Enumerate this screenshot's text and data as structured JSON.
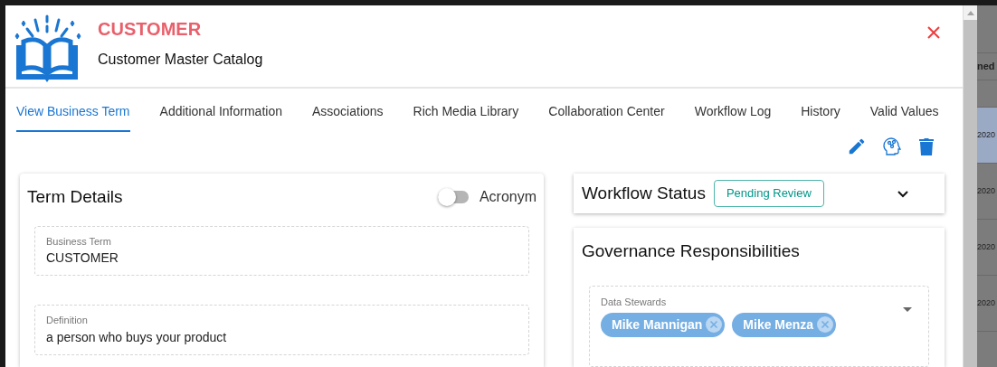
{
  "header": {
    "title": "CUSTOMER",
    "subtitle": "Customer Master Catalog"
  },
  "tabs": [
    {
      "label": "View Business Term",
      "selected": true
    },
    {
      "label": "Additional Information",
      "selected": false
    },
    {
      "label": "Associations",
      "selected": false
    },
    {
      "label": "Rich Media Library",
      "selected": false
    },
    {
      "label": "Collaboration Center",
      "selected": false
    },
    {
      "label": "Workflow Log",
      "selected": false
    },
    {
      "label": "History",
      "selected": false
    },
    {
      "label": "Valid Values",
      "selected": false
    }
  ],
  "term_details": {
    "title": "Term Details",
    "acronym": {
      "label": "Acronym",
      "on": false
    },
    "fields": [
      {
        "label": "Business Term",
        "value": "CUSTOMER"
      },
      {
        "label": "Definition",
        "value": "a person who buys your product"
      }
    ]
  },
  "workflow_status": {
    "title": "Workflow Status",
    "status": "Pending Review",
    "expanded": false
  },
  "governance": {
    "title": "Governance Responsibilities",
    "field": {
      "label": "Data Stewards",
      "chips": [
        "Mike Mannigan",
        "Mike Menza"
      ]
    }
  },
  "background_table": {
    "column_header": "ned",
    "rows": [
      {
        "cell": "2020",
        "selected": true
      },
      {
        "cell": "2020",
        "selected": false
      },
      {
        "cell": "2020",
        "selected": false
      },
      {
        "cell": "2020",
        "selected": false
      }
    ]
  }
}
